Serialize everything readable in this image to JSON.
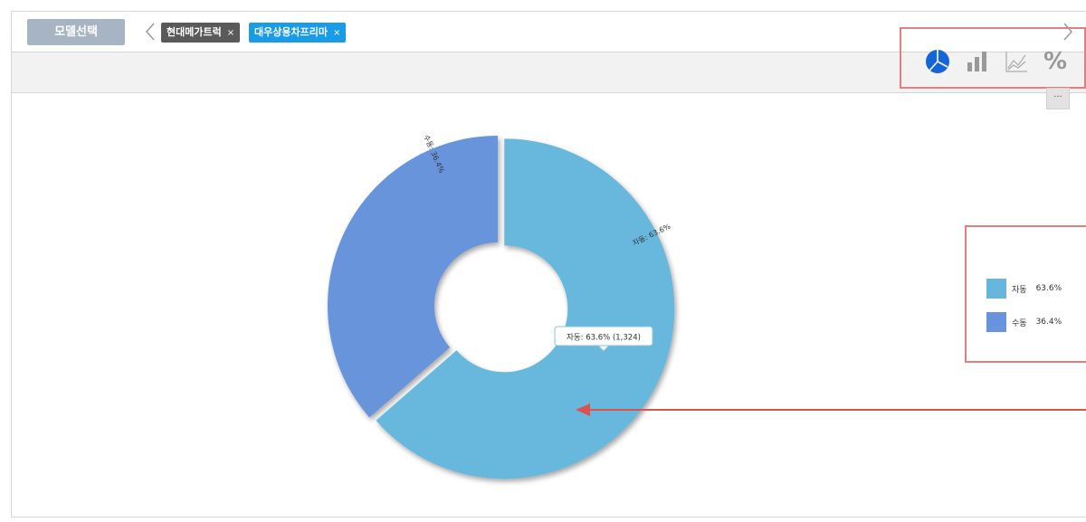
{
  "header": {
    "model_select_label": "모델선택",
    "chips": [
      {
        "label": "현대메가트럭",
        "remove": "×"
      },
      {
        "label": "대우상용차프리마",
        "remove": "×"
      }
    ]
  },
  "toolbar": {
    "tools": [
      "pie-chart-icon",
      "bar-chart-icon",
      "line-chart-icon",
      "percent-icon"
    ],
    "active_tool": "pie-chart-icon",
    "percent_label": "%",
    "more_label": "···"
  },
  "colors": {
    "slice_auto": "#67b7dc",
    "slice_manual": "#6794dc",
    "active_icon": "#1565d8",
    "inactive_icon": "#999999",
    "highlight": "#e07f7f"
  },
  "chart_data": {
    "type": "pie",
    "donut": true,
    "slices": [
      {
        "name": "자동",
        "percent": 63.6,
        "value": 1324,
        "label": "자동: 63.6%",
        "legend_value": "63.6%"
      },
      {
        "name": "수동",
        "percent": 36.4,
        "label": "수동: 36.4%",
        "legend_value": "36.4%"
      }
    ],
    "tooltip": "자동: 63.6% (1,324)",
    "legend_placement": "right"
  }
}
